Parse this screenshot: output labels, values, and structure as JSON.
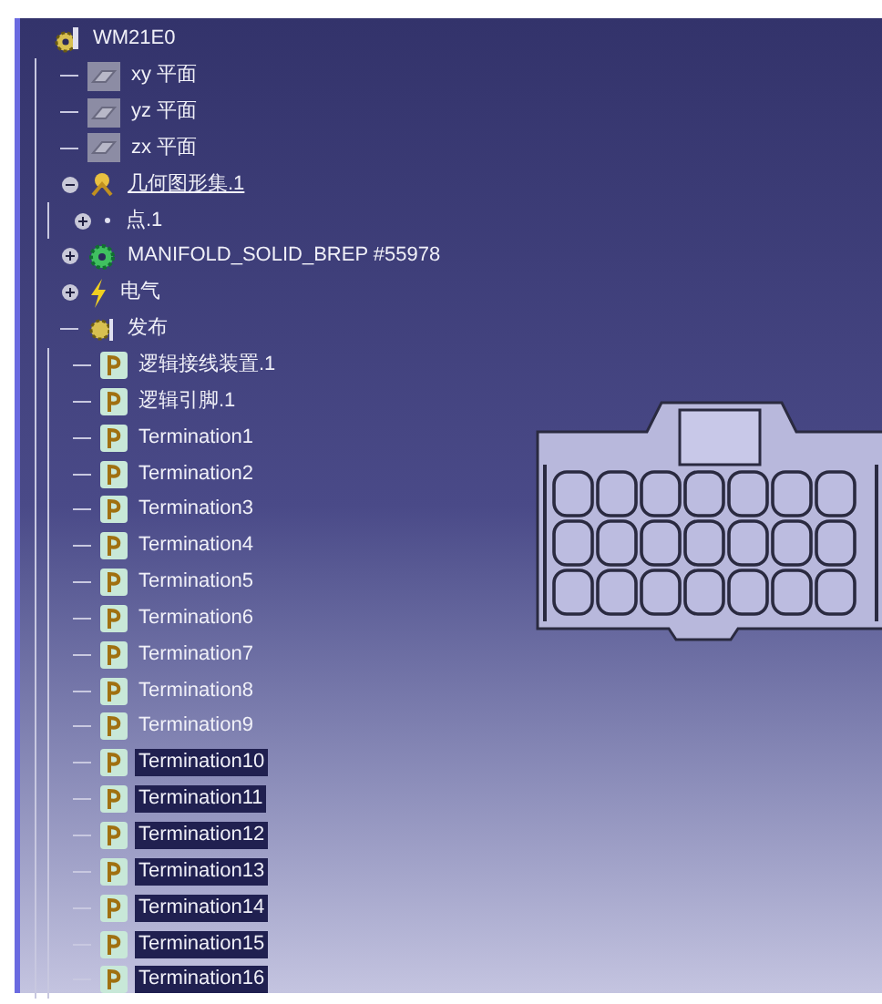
{
  "tree": {
    "label": "WM21E0",
    "kind": "part",
    "selected": false,
    "current": false,
    "children": [
      {
        "label": "xy 平面",
        "kind": "plane",
        "selected": false,
        "current": false
      },
      {
        "label": "yz 平面",
        "kind": "plane",
        "selected": false,
        "current": false
      },
      {
        "label": "zx 平面",
        "kind": "plane",
        "selected": false,
        "current": false
      },
      {
        "label": "几何图形集.1",
        "kind": "geoset",
        "selected": false,
        "current": true,
        "expanded": true,
        "children": [
          {
            "label": "点.1",
            "kind": "point",
            "selected": false,
            "current": false,
            "expanded": false
          }
        ]
      },
      {
        "label": "MANIFOLD_SOLID_BREP #55978",
        "kind": "body",
        "selected": false,
        "current": false,
        "expanded": false
      },
      {
        "label": "电气",
        "kind": "electrical",
        "selected": false,
        "current": false,
        "expanded": false
      },
      {
        "label": "发布",
        "kind": "publication",
        "selected": false,
        "current": false,
        "children": [
          {
            "label": "逻辑接线装置.1",
            "kind": "pin",
            "selected": false,
            "current": false
          },
          {
            "label": "逻辑引脚.1",
            "kind": "pin",
            "selected": false,
            "current": false
          },
          {
            "label": "Termination1",
            "kind": "pin",
            "selected": false,
            "current": false
          },
          {
            "label": "Termination2",
            "kind": "pin",
            "selected": false,
            "current": false
          },
          {
            "label": "Termination3",
            "kind": "pin",
            "selected": false,
            "current": false
          },
          {
            "label": "Termination4",
            "kind": "pin",
            "selected": false,
            "current": false
          },
          {
            "label": "Termination5",
            "kind": "pin",
            "selected": false,
            "current": false
          },
          {
            "label": "Termination6",
            "kind": "pin",
            "selected": false,
            "current": false
          },
          {
            "label": "Termination7",
            "kind": "pin",
            "selected": false,
            "current": false
          },
          {
            "label": "Termination8",
            "kind": "pin",
            "selected": false,
            "current": false
          },
          {
            "label": "Termination9",
            "kind": "pin",
            "selected": false,
            "current": false
          },
          {
            "label": "Termination10",
            "kind": "pin",
            "selected": true,
            "current": false
          },
          {
            "label": "Termination11",
            "kind": "pin",
            "selected": true,
            "current": false
          },
          {
            "label": "Termination12",
            "kind": "pin",
            "selected": true,
            "current": false
          },
          {
            "label": "Termination13",
            "kind": "pin",
            "selected": true,
            "current": false
          },
          {
            "label": "Termination14",
            "kind": "pin",
            "selected": true,
            "current": false
          },
          {
            "label": "Termination15",
            "kind": "pin",
            "selected": true,
            "current": false
          },
          {
            "label": "Termination16",
            "kind": "pin",
            "selected": true,
            "current": false
          }
        ]
      }
    ]
  }
}
